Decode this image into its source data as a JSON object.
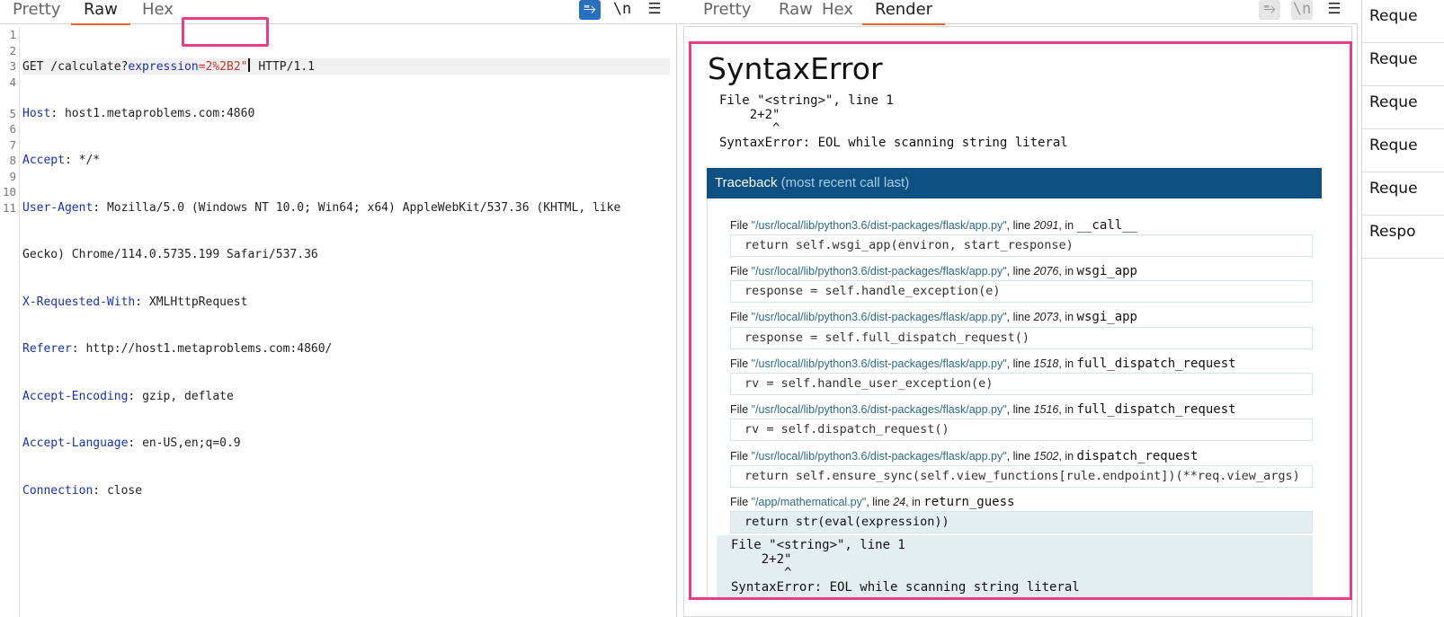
{
  "request": {
    "tabs": [
      "Pretty",
      "Raw",
      "Hex"
    ],
    "active_tab": "Raw",
    "tools": {
      "wrap": "⥱",
      "newline": "\\n",
      "menu": "☰"
    },
    "line_numbers": [
      "1",
      "2",
      "3",
      "4",
      "5",
      "6",
      "7",
      "8",
      "9",
      "10",
      "11"
    ],
    "line1": {
      "method_path": "GET /calculate?",
      "param_name": "expression",
      "eq": "=",
      "param_value": "2%2B2\"",
      "protocol": "HTTP/1.1"
    },
    "headers": [
      {
        "name": "Host",
        "value": "host1.metaproblems.com:4860"
      },
      {
        "name": "Accept",
        "value": "*/*"
      },
      {
        "name": "User-Agent",
        "value": "Mozilla/5.0 (Windows NT 10.0; Win64; x64) AppleWebKit/537.36 (KHTML, like",
        "cont": "Gecko) Chrome/114.0.5735.199 Safari/537.36"
      },
      {
        "name": "X-Requested-With",
        "value": "XMLHttpRequest"
      },
      {
        "name": "Referer",
        "value": "http://host1.metaproblems.com:4860/"
      },
      {
        "name": "Accept-Encoding",
        "value": "gzip, deflate"
      },
      {
        "name": "Accept-Language",
        "value": "en-US,en;q=0.9"
      },
      {
        "name": "Connection",
        "value": "close"
      }
    ]
  },
  "response": {
    "tabs": [
      "Pretty",
      "Raw",
      "Hex",
      "Render"
    ],
    "active_tab": "Render",
    "title": "SyntaxError",
    "error_text": "File \"<string>\", line 1\n    2+2\"\n       ^\nSyntaxError: EOL while scanning string literal",
    "traceback": {
      "label": "Traceback",
      "note": "(most recent call last)"
    },
    "frames": [
      {
        "path": "\"/usr/local/lib/python3.6/dist-packages/flask/app.py\"",
        "line": "2091",
        "func": "__call__",
        "code": "return self.wsgi_app(environ, start_response)"
      },
      {
        "path": "\"/usr/local/lib/python3.6/dist-packages/flask/app.py\"",
        "line": "2076",
        "func": "wsgi_app",
        "code": "response = self.handle_exception(e)"
      },
      {
        "path": "\"/usr/local/lib/python3.6/dist-packages/flask/app.py\"",
        "line": "2073",
        "func": "wsgi_app",
        "code": "response = self.full_dispatch_request()"
      },
      {
        "path": "\"/usr/local/lib/python3.6/dist-packages/flask/app.py\"",
        "line": "1518",
        "func": "full_dispatch_request",
        "code": "rv = self.handle_user_exception(e)"
      },
      {
        "path": "\"/usr/local/lib/python3.6/dist-packages/flask/app.py\"",
        "line": "1516",
        "func": "full_dispatch_request",
        "code": "rv = self.dispatch_request()"
      },
      {
        "path": "\"/usr/local/lib/python3.6/dist-packages/flask/app.py\"",
        "line": "1502",
        "func": "dispatch_request",
        "code": "return self.ensure_sync(self.view_functions[rule.endpoint])(**req.view_args)"
      },
      {
        "path": "\"/app/mathematical.py\"",
        "line": "24",
        "func": "return_guess",
        "code": "return str(eval(expression))"
      }
    ],
    "words": {
      "file": "File",
      "line": ", line",
      "in": ", in"
    }
  },
  "sidebar": {
    "items": [
      "Reque",
      "Reque",
      "Reque",
      "Reque",
      "Reque",
      "Respo"
    ]
  },
  "colors": {
    "highlight": "#e83e84",
    "traceback_header": "#0d5081",
    "active_tab_underline": "#e8642b"
  }
}
